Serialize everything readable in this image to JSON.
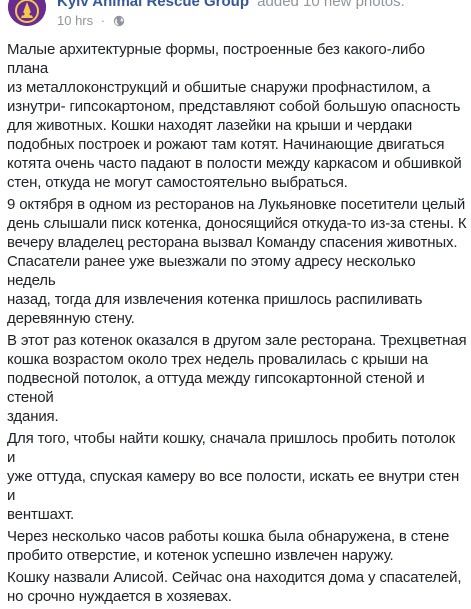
{
  "post": {
    "author": "Kyiv Animal Rescue Group",
    "action": "added 10 new photos.",
    "timestamp": "10 hrs",
    "separator": "·",
    "privacy_icon": "globe-icon",
    "avatar_icon": "organization-logo",
    "paragraphs": [
      "Малые архитектурные формы, построенные без какого-либо плана\nиз металлоконструкций и обшитые снаружи профнастилом, а\nизнутри- гипсокартоном, представляют собой большую опасность\nдля животных. Кошки находят лазейки на крыши и чердаки\nподобных построек и рожают там котят. Начинающие двигаться\nкотята очень часто падают в полости между каркасом и обшивкой\nстен, откуда не могут самостоятельно выбраться.",
      "9 октября в одном из ресторанов на Лукьяновке посетители целый\nдень слышали писк котенка, доносящийся откуда-то из-за стены. К\nвечеру владелец ресторана вызвал Команду спасения животных.\nСпасатели ранее уже выезжали по этому адресу несколько недель\nназад, тогда для извлечения котенка пришлось распиливать\nдеревянную стену.",
      "В этот раз котенок оказался в другом зале ресторана. Трехцветная\nкошка возрастом около трех недель провалилась с крыши на\nподвесной потолок, а оттуда между гипсокартонной стеной и стеной\nздания.",
      "Для того, чтобы найти кошку, сначала пришлось пробить потолок и\nуже оттуда, спуская камеру во все полости, искать ее внутри стен и\nвентшахт.",
      "Через несколько часов работы кошка была обнаружена, в стене\nпробито отверстие, и котенок успешно извлечен наружу.",
      "Кошку назвали Алисой. Сейчас она находится дома у спасателей,\nно срочно нуждается в хозяевах."
    ]
  },
  "colors": {
    "link": "#365899",
    "meta": "#90949c",
    "text": "#1d2129",
    "avatar_bg": "#6a2c91"
  }
}
